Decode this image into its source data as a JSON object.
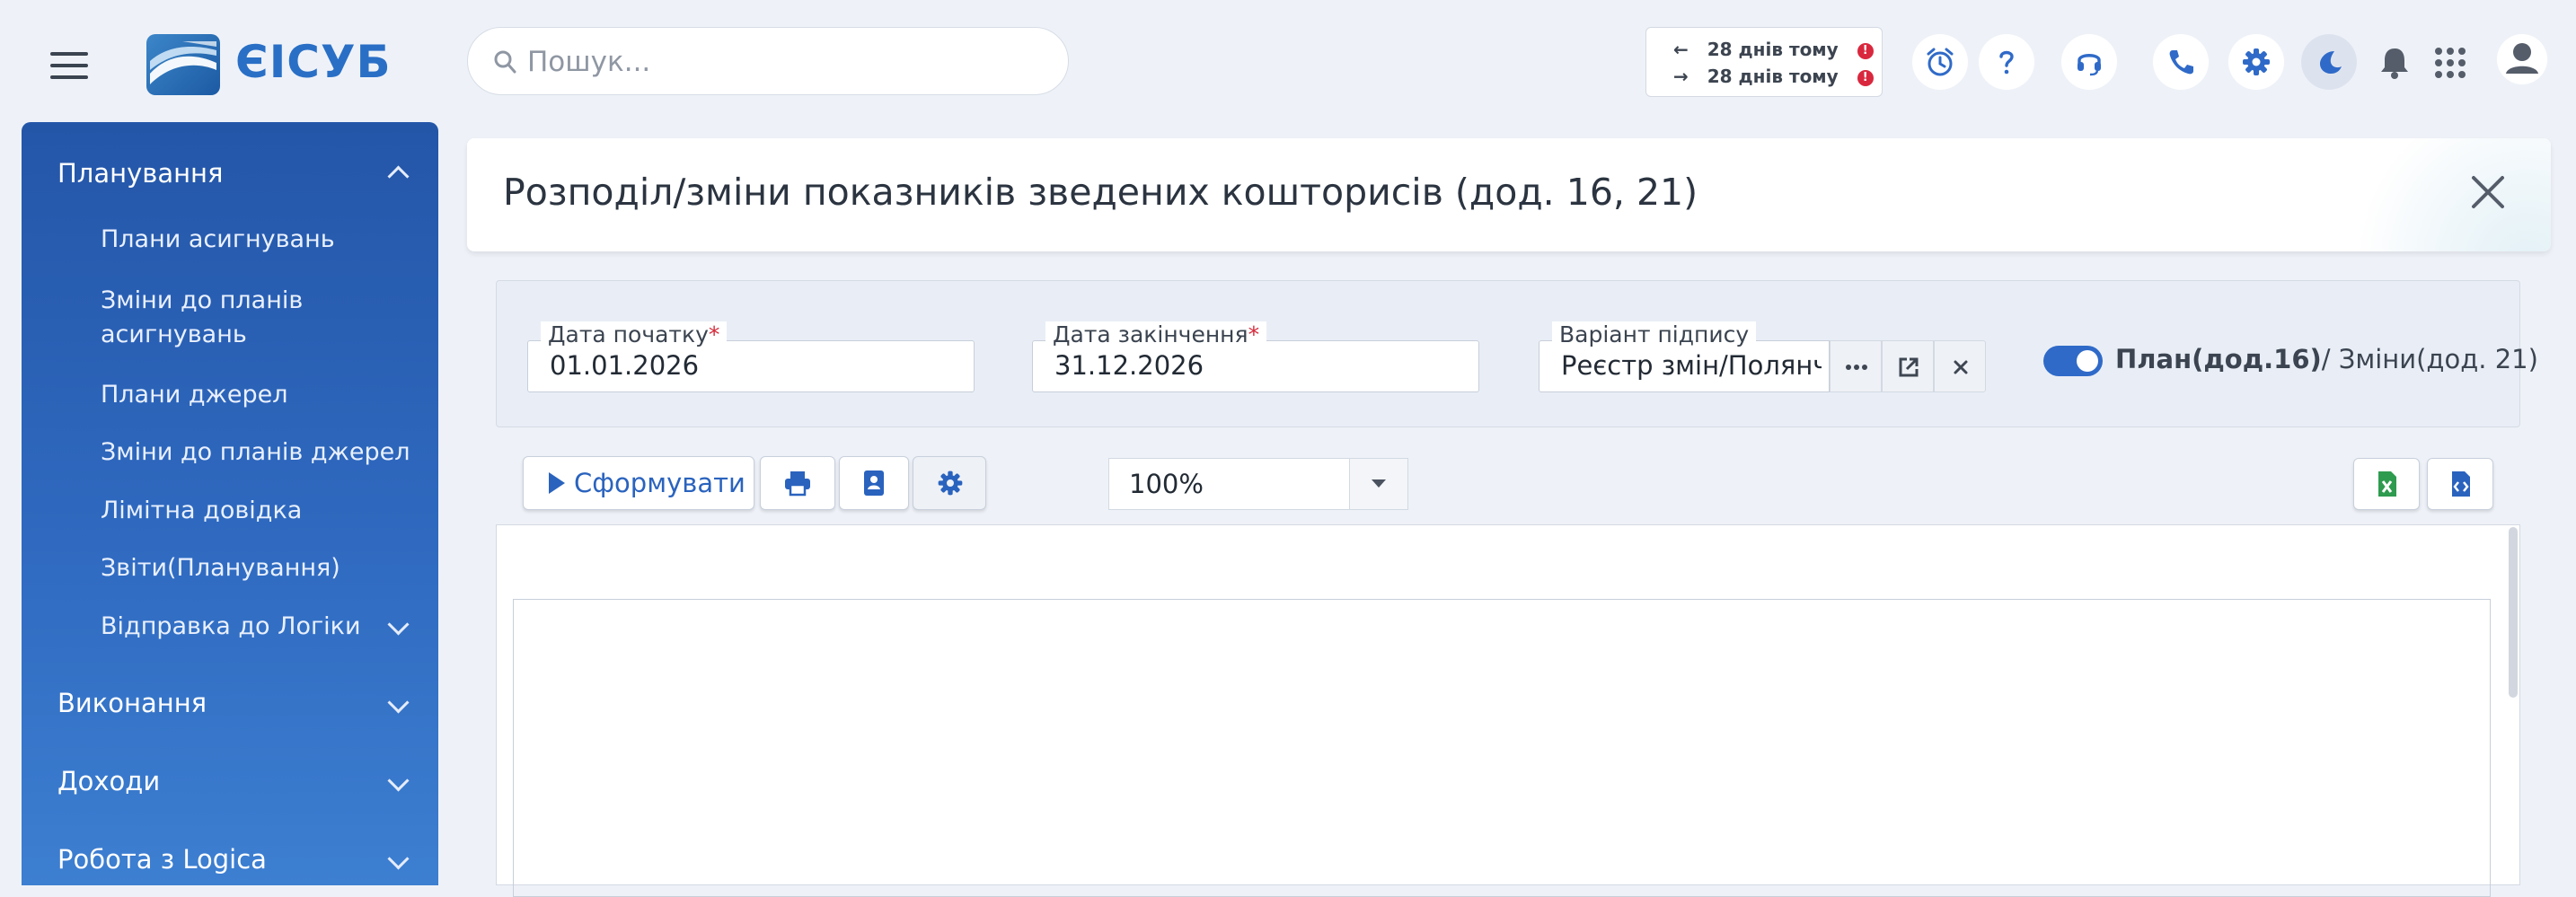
{
  "header": {
    "brand": "ЄІСУБ",
    "search_placeholder": "Пошук...",
    "sync": [
      {
        "direction": "←",
        "text": "28 днів тому",
        "status": "!"
      },
      {
        "direction": "→",
        "text": "28 днів тому",
        "status": "!"
      }
    ],
    "icons": [
      "alarm-clock-icon",
      "help-icon",
      "headset-icon",
      "phone-icon",
      "gear-icon",
      "moon-icon",
      "bell-icon",
      "apps-grid-icon",
      "user-icon"
    ]
  },
  "sidebar": {
    "sections": [
      {
        "label": "Планування",
        "expanded": true
      },
      {
        "label": "Виконання",
        "expanded": false
      },
      {
        "label": "Доходи",
        "expanded": false
      },
      {
        "label": "Робота з Logica",
        "expanded": false
      }
    ],
    "planning_items": [
      {
        "label": "Плани асигнувань"
      },
      {
        "label": "Зміни до планів асигнувань",
        "line1": "Зміни до планів",
        "line2": "асигнувань"
      },
      {
        "label": "Плани джерел"
      },
      {
        "label": "Зміни до планів джерел"
      },
      {
        "label": "Лімітна довідка"
      },
      {
        "label": "Звіти(Планування)"
      },
      {
        "label": "Відправка до Логіки"
      }
    ]
  },
  "page": {
    "title": "Розподіл/зміни показників зведених кошторисів (дод. 16, 21)"
  },
  "filters": {
    "start_date": {
      "label": "Дата початку",
      "required_mark": "*",
      "value": "01.01.2026"
    },
    "end_date": {
      "label": "Дата закінчення",
      "required_mark": "*",
      "value": "31.12.2026"
    },
    "signature": {
      "label": "Варіант підпису",
      "value": "Реєстр змін/Полянч"
    },
    "toggle": {
      "on": true,
      "on_label": "План(дод.16)",
      "separator": "/ ",
      "off_label": "Зміни(дод. 21)"
    }
  },
  "toolbar": {
    "generate_label": "Сформувати",
    "zoom": "100%"
  },
  "colors": {
    "accent": "#2f6ac8",
    "sidebar_top": "#2456a8",
    "sidebar_bottom": "#3d7fd1",
    "alert": "#d9283e",
    "excel": "#2e9b4f"
  }
}
